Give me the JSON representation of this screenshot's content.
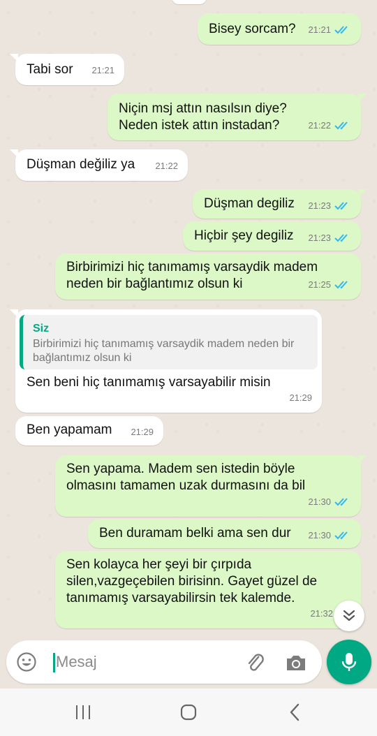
{
  "colors": {
    "outgoing_bubble": "#dcf8c6",
    "incoming_bubble": "#ffffff",
    "read_tick": "#34b7f1",
    "accent": "#00a884",
    "background": "#ece5dd"
  },
  "messages": [
    {
      "direction": "out",
      "text": "Bisey sorcam?",
      "time": "21:21",
      "status": "read"
    },
    {
      "direction": "in",
      "text": "Tabi sor",
      "time": "21:21"
    },
    {
      "direction": "out",
      "text": "Niçin msj attın nasılsın diye?\nNeden istek attın instadan?",
      "time": "21:22",
      "status": "read"
    },
    {
      "direction": "in",
      "text": "Düşman değiliz ya",
      "time": "21:22"
    },
    {
      "direction": "out",
      "text": "Düşman degiliz",
      "time": "21:23",
      "status": "read"
    },
    {
      "direction": "out",
      "text": "Hiçbir şey degiliz",
      "time": "21:23",
      "status": "read"
    },
    {
      "direction": "out",
      "text": "Birbirimizi hiç tanımamış varsaydik madem\nneden bir bağlantımız olsun ki",
      "time": "21:25",
      "status": "read"
    },
    {
      "direction": "in",
      "text": "Sen beni hiç tanımamış varsayabilir misin",
      "time": "21:29",
      "quote": {
        "author": "Siz",
        "text": "Birbirimizi hiç tanımamış varsaydik madem neden bir bağlantımız olsun ki"
      }
    },
    {
      "direction": "in",
      "text": "Ben yapamam",
      "time": "21:29"
    },
    {
      "direction": "out",
      "text": "Sen yapama. Madem sen istedin böyle\nolmasını tamamen uzak durmasını da bil",
      "time": "21:30",
      "status": "read"
    },
    {
      "direction": "out",
      "text": "Ben duramam belki ama sen dur",
      "time": "21:30",
      "status": "read"
    },
    {
      "direction": "out",
      "text": "Sen kolayca her şeyi bir çırpıda\nsilen,vazgeçebilen birisinn. Gayet güzel de\ntanımamış varsayabilirsin tek kalemde.",
      "time": "21:32",
      "status": "read"
    }
  ],
  "composer": {
    "placeholder": "Mesaj",
    "emoji_icon": "emoji-icon",
    "attach_icon": "paperclip-icon",
    "camera_icon": "camera-icon",
    "mic_icon": "microphone-icon"
  },
  "scroll_down_icon": "double-chevron-down-icon",
  "navbar": {
    "recent_icon": "recent-apps-icon",
    "home_icon": "home-icon",
    "back_icon": "back-icon"
  }
}
